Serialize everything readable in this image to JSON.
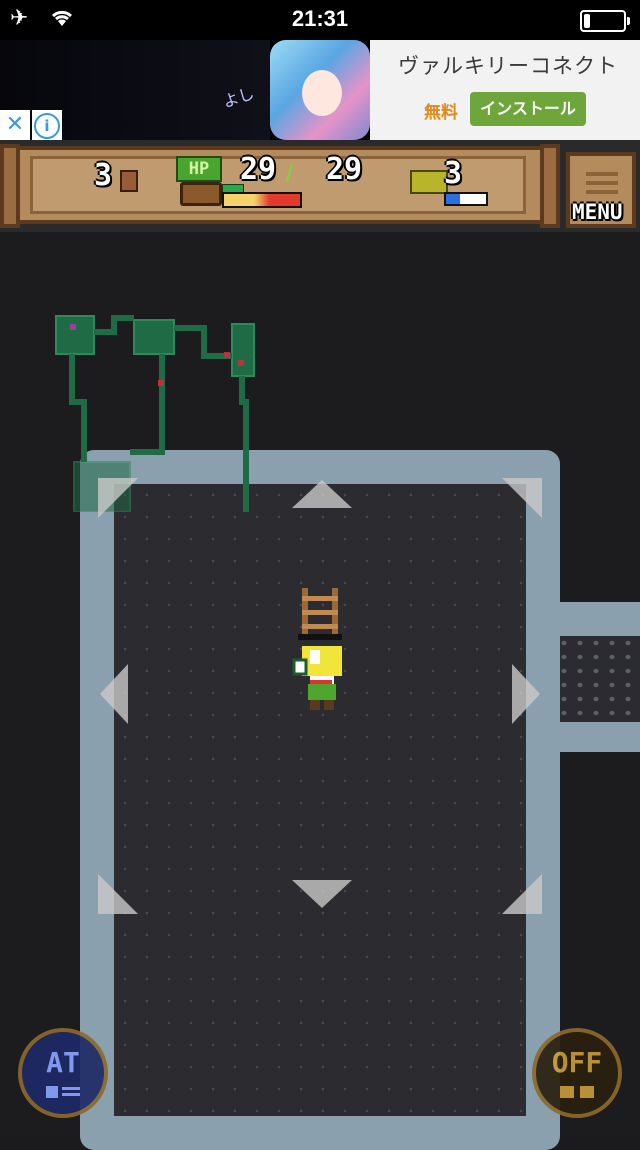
{
  "status_bar": {
    "time": "21:31",
    "airplane_icon": "airplane-icon",
    "wifi_icon": "wifi-icon",
    "battery_icon": "battery-icon",
    "battery_level": 0.15
  },
  "ad": {
    "partial_text": "よし",
    "title": "ヴァルキリーコネクト",
    "free_label": "無料",
    "install_label": "インストール",
    "close_glyph": "✕",
    "info_glyph": "i"
  },
  "hud": {
    "floor": "3",
    "hp_label": "HP",
    "hp_current": "29",
    "hp_max": "29",
    "hp_fill": 1.0,
    "level": "3",
    "xp_fill": 0.35,
    "menu_label": "MENU"
  },
  "buttons": {
    "auto_label": "AT",
    "toggle_label": "OFF"
  },
  "colors": {
    "hud_wood": "#b48b5d",
    "hp_green": "#49a52f",
    "xp_blue": "#2e6fe0",
    "minimap_green": "#1f6b45",
    "rock": "#8aa0ae"
  }
}
